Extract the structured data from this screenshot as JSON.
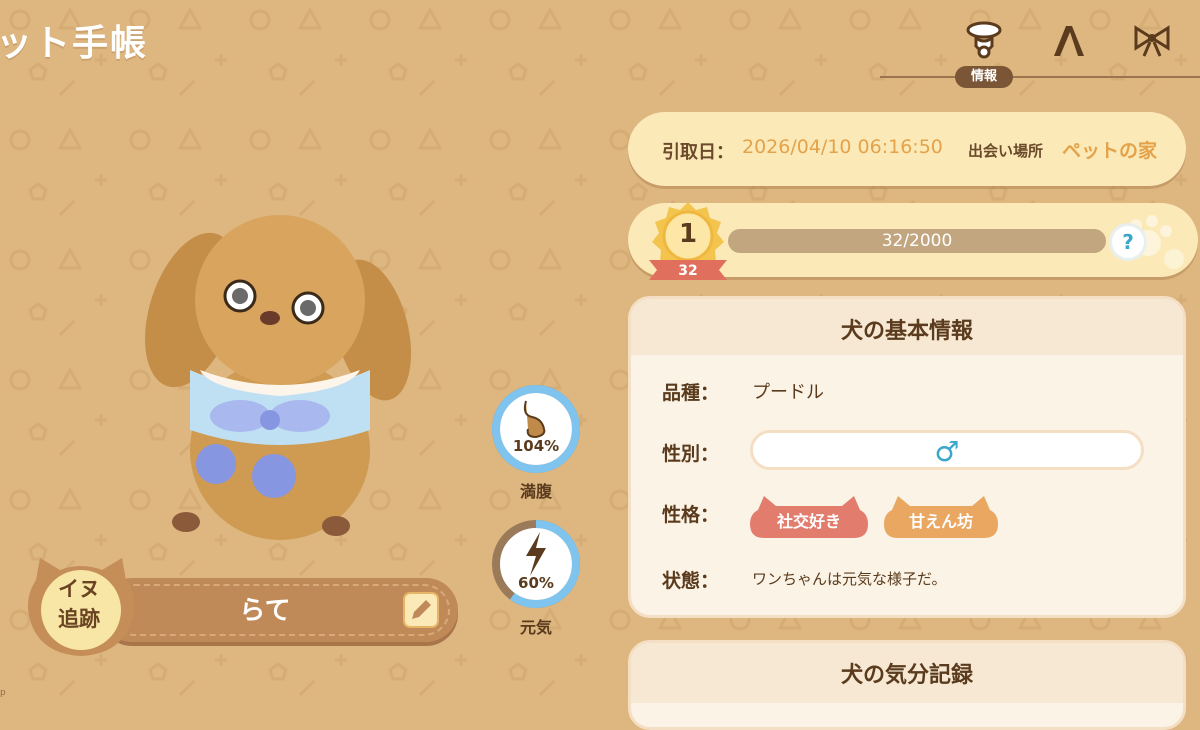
{
  "header": {
    "title": "ット手帳"
  },
  "tabs": [
    {
      "name": "info",
      "label": "情報",
      "icon": "collar-tag-icon",
      "active": true
    },
    {
      "name": "style",
      "icon": "comb-icon"
    },
    {
      "name": "accessory",
      "icon": "ribbon-bow-icon"
    }
  ],
  "adoption": {
    "date_label": "引取日：",
    "date_value": "2026/04/10 06:16:50",
    "place_label": "出会い場所",
    "place_value": "ペットの家"
  },
  "level": {
    "level": "1",
    "ribbon": "32",
    "exp_text": "32/2000",
    "exp_fraction": 0.016,
    "help": "?"
  },
  "basic_info": {
    "title": "犬の基本情報",
    "breed_label": "品種：",
    "breed_value": "プードル",
    "gender_label": "性別：",
    "gender_value": "♂",
    "personality_label": "性格：",
    "traits": [
      {
        "label": "社交好き",
        "color": "#e27d6e"
      },
      {
        "label": "甘えん坊",
        "color": "#e9a762"
      }
    ],
    "status_label": "状態：",
    "status_value": "ワンちゃんは元気な様子だ。"
  },
  "mood": {
    "title": "犬の気分記録"
  },
  "gauges": {
    "fullness": {
      "percent_text": "104%",
      "label": "満腹",
      "fraction": 1.0,
      "icon": "stomach-icon"
    },
    "energy": {
      "percent_text": "60%",
      "label": "元気",
      "fraction": 0.6,
      "icon": "lightning-icon"
    }
  },
  "pet": {
    "name": "らて",
    "track_label_line1": "イヌ",
    "track_label_line2": "追跡"
  },
  "colors": {
    "background": "#ddb680",
    "card": "#fbe9b7",
    "accent_blue": "#7ec4ef",
    "brown": "#5a3b1d"
  },
  "corner_text": "p"
}
